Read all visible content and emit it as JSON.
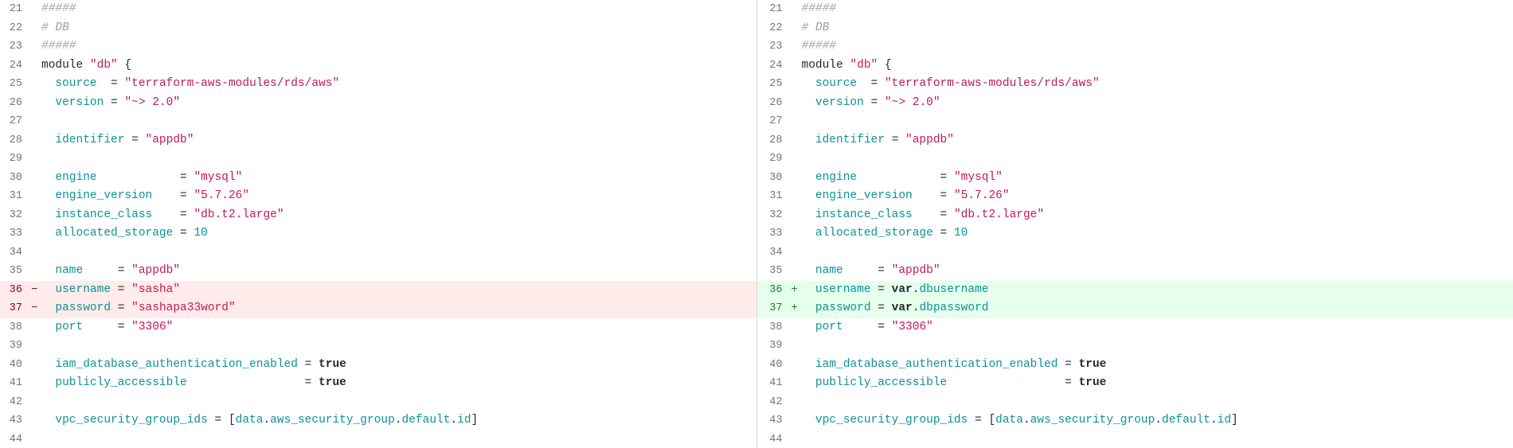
{
  "diff": {
    "left": {
      "start": 21,
      "lines": [
        {
          "n": 21,
          "kind": "ctx",
          "tokens": [
            {
              "t": "#####",
              "c": "cm"
            }
          ]
        },
        {
          "n": 22,
          "kind": "ctx",
          "tokens": [
            {
              "t": "# DB",
              "c": "cm"
            }
          ]
        },
        {
          "n": 23,
          "kind": "ctx",
          "tokens": [
            {
              "t": "#####",
              "c": "cm"
            }
          ]
        },
        {
          "n": 24,
          "kind": "ctx",
          "tokens": [
            {
              "t": "module ",
              "c": "kw"
            },
            {
              "t": "\"db\"",
              "c": "str"
            },
            {
              "t": " {",
              "c": "punc"
            }
          ]
        },
        {
          "n": 25,
          "kind": "ctx",
          "tokens": [
            {
              "t": "  ",
              "c": "white"
            },
            {
              "t": "source",
              "c": "id"
            },
            {
              "t": "  = ",
              "c": "punc"
            },
            {
              "t": "\"terraform-aws-modules/rds/aws\"",
              "c": "str"
            }
          ]
        },
        {
          "n": 26,
          "kind": "ctx",
          "tokens": [
            {
              "t": "  ",
              "c": "white"
            },
            {
              "t": "version",
              "c": "id"
            },
            {
              "t": " = ",
              "c": "punc"
            },
            {
              "t": "\"~> 2.0\"",
              "c": "str"
            }
          ]
        },
        {
          "n": 27,
          "kind": "ctx",
          "tokens": []
        },
        {
          "n": 28,
          "kind": "ctx",
          "tokens": [
            {
              "t": "  ",
              "c": "white"
            },
            {
              "t": "identifier",
              "c": "id"
            },
            {
              "t": " = ",
              "c": "punc"
            },
            {
              "t": "\"appdb\"",
              "c": "str"
            }
          ]
        },
        {
          "n": 29,
          "kind": "ctx",
          "tokens": []
        },
        {
          "n": 30,
          "kind": "ctx",
          "tokens": [
            {
              "t": "  ",
              "c": "white"
            },
            {
              "t": "engine",
              "c": "id"
            },
            {
              "t": "            = ",
              "c": "punc"
            },
            {
              "t": "\"mysql\"",
              "c": "str"
            }
          ]
        },
        {
          "n": 31,
          "kind": "ctx",
          "tokens": [
            {
              "t": "  ",
              "c": "white"
            },
            {
              "t": "engine_version",
              "c": "id"
            },
            {
              "t": "    = ",
              "c": "punc"
            },
            {
              "t": "\"5.7.26\"",
              "c": "str"
            }
          ]
        },
        {
          "n": 32,
          "kind": "ctx",
          "tokens": [
            {
              "t": "  ",
              "c": "white"
            },
            {
              "t": "instance_class",
              "c": "id"
            },
            {
              "t": "    = ",
              "c": "punc"
            },
            {
              "t": "\"db.t2.large\"",
              "c": "str"
            }
          ]
        },
        {
          "n": 33,
          "kind": "ctx",
          "tokens": [
            {
              "t": "  ",
              "c": "white"
            },
            {
              "t": "allocated_storage",
              "c": "id"
            },
            {
              "t": " = ",
              "c": "punc"
            },
            {
              "t": "10",
              "c": "num"
            }
          ]
        },
        {
          "n": 34,
          "kind": "ctx",
          "tokens": []
        },
        {
          "n": 35,
          "kind": "ctx",
          "tokens": [
            {
              "t": "  ",
              "c": "white"
            },
            {
              "t": "name",
              "c": "id"
            },
            {
              "t": "     = ",
              "c": "punc"
            },
            {
              "t": "\"appdb\"",
              "c": "str"
            }
          ]
        },
        {
          "n": 36,
          "kind": "del",
          "tokens": [
            {
              "t": "  ",
              "c": "white"
            },
            {
              "t": "username",
              "c": "id"
            },
            {
              "t": " = ",
              "c": "punc"
            },
            {
              "t": "\"sasha\"",
              "c": "str"
            }
          ]
        },
        {
          "n": 37,
          "kind": "del",
          "tokens": [
            {
              "t": "  ",
              "c": "white"
            },
            {
              "t": "password",
              "c": "id"
            },
            {
              "t": " = ",
              "c": "punc"
            },
            {
              "t": "\"sashapa33word\"",
              "c": "str"
            }
          ]
        },
        {
          "n": 38,
          "kind": "ctx",
          "tokens": [
            {
              "t": "  ",
              "c": "white"
            },
            {
              "t": "port",
              "c": "id"
            },
            {
              "t": "     = ",
              "c": "punc"
            },
            {
              "t": "\"3306\"",
              "c": "str"
            }
          ]
        },
        {
          "n": 39,
          "kind": "ctx",
          "tokens": []
        },
        {
          "n": 40,
          "kind": "ctx",
          "tokens": [
            {
              "t": "  ",
              "c": "white"
            },
            {
              "t": "iam_database_authentication_enabled",
              "c": "id"
            },
            {
              "t": " = ",
              "c": "punc"
            },
            {
              "t": "true",
              "c": "bool"
            }
          ]
        },
        {
          "n": 41,
          "kind": "ctx",
          "tokens": [
            {
              "t": "  ",
              "c": "white"
            },
            {
              "t": "publicly_accessible",
              "c": "id"
            },
            {
              "t": "                 = ",
              "c": "punc"
            },
            {
              "t": "true",
              "c": "bool"
            }
          ]
        },
        {
          "n": 42,
          "kind": "ctx",
          "tokens": []
        },
        {
          "n": 43,
          "kind": "ctx",
          "tokens": [
            {
              "t": "  ",
              "c": "white"
            },
            {
              "t": "vpc_security_group_ids",
              "c": "id"
            },
            {
              "t": " = [",
              "c": "punc"
            },
            {
              "t": "data",
              "c": "id"
            },
            {
              "t": ".",
              "c": "punc"
            },
            {
              "t": "aws_security_group",
              "c": "id"
            },
            {
              "t": ".",
              "c": "punc"
            },
            {
              "t": "default",
              "c": "id"
            },
            {
              "t": ".",
              "c": "punc"
            },
            {
              "t": "id",
              "c": "id"
            },
            {
              "t": "]",
              "c": "punc"
            }
          ]
        },
        {
          "n": 44,
          "kind": "ctx",
          "tokens": []
        }
      ]
    },
    "right": {
      "start": 21,
      "lines": [
        {
          "n": 21,
          "kind": "ctx",
          "tokens": [
            {
              "t": "#####",
              "c": "cm"
            }
          ]
        },
        {
          "n": 22,
          "kind": "ctx",
          "tokens": [
            {
              "t": "# DB",
              "c": "cm"
            }
          ]
        },
        {
          "n": 23,
          "kind": "ctx",
          "tokens": [
            {
              "t": "#####",
              "c": "cm"
            }
          ]
        },
        {
          "n": 24,
          "kind": "ctx",
          "tokens": [
            {
              "t": "module ",
              "c": "kw"
            },
            {
              "t": "\"db\"",
              "c": "str"
            },
            {
              "t": " {",
              "c": "punc"
            }
          ]
        },
        {
          "n": 25,
          "kind": "ctx",
          "tokens": [
            {
              "t": "  ",
              "c": "white"
            },
            {
              "t": "source",
              "c": "id"
            },
            {
              "t": "  = ",
              "c": "punc"
            },
            {
              "t": "\"terraform-aws-modules/rds/aws\"",
              "c": "str"
            }
          ]
        },
        {
          "n": 26,
          "kind": "ctx",
          "tokens": [
            {
              "t": "  ",
              "c": "white"
            },
            {
              "t": "version",
              "c": "id"
            },
            {
              "t": " = ",
              "c": "punc"
            },
            {
              "t": "\"~> 2.0\"",
              "c": "str"
            }
          ]
        },
        {
          "n": 27,
          "kind": "ctx",
          "tokens": []
        },
        {
          "n": 28,
          "kind": "ctx",
          "tokens": [
            {
              "t": "  ",
              "c": "white"
            },
            {
              "t": "identifier",
              "c": "id"
            },
            {
              "t": " = ",
              "c": "punc"
            },
            {
              "t": "\"appdb\"",
              "c": "str"
            }
          ]
        },
        {
          "n": 29,
          "kind": "ctx",
          "tokens": []
        },
        {
          "n": 30,
          "kind": "ctx",
          "tokens": [
            {
              "t": "  ",
              "c": "white"
            },
            {
              "t": "engine",
              "c": "id"
            },
            {
              "t": "            = ",
              "c": "punc"
            },
            {
              "t": "\"mysql\"",
              "c": "str"
            }
          ]
        },
        {
          "n": 31,
          "kind": "ctx",
          "tokens": [
            {
              "t": "  ",
              "c": "white"
            },
            {
              "t": "engine_version",
              "c": "id"
            },
            {
              "t": "    = ",
              "c": "punc"
            },
            {
              "t": "\"5.7.26\"",
              "c": "str"
            }
          ]
        },
        {
          "n": 32,
          "kind": "ctx",
          "tokens": [
            {
              "t": "  ",
              "c": "white"
            },
            {
              "t": "instance_class",
              "c": "id"
            },
            {
              "t": "    = ",
              "c": "punc"
            },
            {
              "t": "\"db.t2.large\"",
              "c": "str"
            }
          ]
        },
        {
          "n": 33,
          "kind": "ctx",
          "tokens": [
            {
              "t": "  ",
              "c": "white"
            },
            {
              "t": "allocated_storage",
              "c": "id"
            },
            {
              "t": " = ",
              "c": "punc"
            },
            {
              "t": "10",
              "c": "num"
            }
          ]
        },
        {
          "n": 34,
          "kind": "ctx",
          "tokens": []
        },
        {
          "n": 35,
          "kind": "ctx",
          "tokens": [
            {
              "t": "  ",
              "c": "white"
            },
            {
              "t": "name",
              "c": "id"
            },
            {
              "t": "     = ",
              "c": "punc"
            },
            {
              "t": "\"appdb\"",
              "c": "str"
            }
          ]
        },
        {
          "n": 36,
          "kind": "add",
          "tokens": [
            {
              "t": "  ",
              "c": "white"
            },
            {
              "t": "username",
              "c": "id"
            },
            {
              "t": " = ",
              "c": "punc"
            },
            {
              "t": "var",
              "c": "bool"
            },
            {
              "t": ".",
              "c": "punc"
            },
            {
              "t": "dbusername",
              "c": "id"
            }
          ]
        },
        {
          "n": 37,
          "kind": "add",
          "tokens": [
            {
              "t": "  ",
              "c": "white"
            },
            {
              "t": "password",
              "c": "id"
            },
            {
              "t": " = ",
              "c": "punc"
            },
            {
              "t": "var",
              "c": "bool"
            },
            {
              "t": ".",
              "c": "punc"
            },
            {
              "t": "dbpassword",
              "c": "id"
            }
          ]
        },
        {
          "n": 38,
          "kind": "ctx",
          "tokens": [
            {
              "t": "  ",
              "c": "white"
            },
            {
              "t": "port",
              "c": "id"
            },
            {
              "t": "     = ",
              "c": "punc"
            },
            {
              "t": "\"3306\"",
              "c": "str"
            }
          ]
        },
        {
          "n": 39,
          "kind": "ctx",
          "tokens": []
        },
        {
          "n": 40,
          "kind": "ctx",
          "tokens": [
            {
              "t": "  ",
              "c": "white"
            },
            {
              "t": "iam_database_authentication_enabled",
              "c": "id"
            },
            {
              "t": " = ",
              "c": "punc"
            },
            {
              "t": "true",
              "c": "bool"
            }
          ]
        },
        {
          "n": 41,
          "kind": "ctx",
          "tokens": [
            {
              "t": "  ",
              "c": "white"
            },
            {
              "t": "publicly_accessible",
              "c": "id"
            },
            {
              "t": "                 = ",
              "c": "punc"
            },
            {
              "t": "true",
              "c": "bool"
            }
          ]
        },
        {
          "n": 42,
          "kind": "ctx",
          "tokens": []
        },
        {
          "n": 43,
          "kind": "ctx",
          "tokens": [
            {
              "t": "  ",
              "c": "white"
            },
            {
              "t": "vpc_security_group_ids",
              "c": "id"
            },
            {
              "t": " = [",
              "c": "punc"
            },
            {
              "t": "data",
              "c": "id"
            },
            {
              "t": ".",
              "c": "punc"
            },
            {
              "t": "aws_security_group",
              "c": "id"
            },
            {
              "t": ".",
              "c": "punc"
            },
            {
              "t": "default",
              "c": "id"
            },
            {
              "t": ".",
              "c": "punc"
            },
            {
              "t": "id",
              "c": "id"
            },
            {
              "t": "]",
              "c": "punc"
            }
          ]
        },
        {
          "n": 44,
          "kind": "ctx",
          "tokens": []
        }
      ]
    }
  },
  "markers": {
    "ctx": " ",
    "del": "−",
    "add": "+"
  }
}
